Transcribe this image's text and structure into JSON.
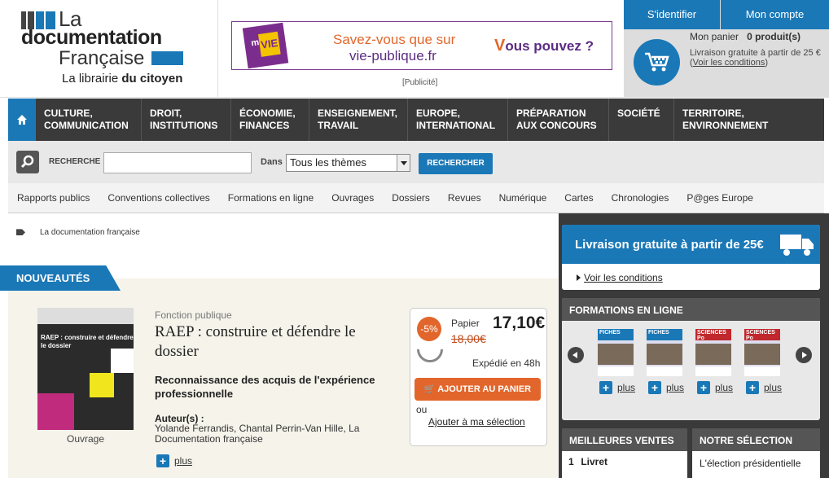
{
  "header": {
    "logo": {
      "line1": "La",
      "line2": "documentation",
      "line3": "Française",
      "tagline_prefix": "La librairie ",
      "tagline_bold": "du citoyen"
    },
    "banner": {
      "logo_top": "mon",
      "logo_mid": "VIE",
      "text1": "Savez-vous que sur",
      "text2": "vie-publique.fr",
      "text3_prefix": "V",
      "text3_rest": "ous pouvez ?"
    },
    "pub_note": "[Publicité]",
    "account": {
      "identifier": "S'identifier",
      "mon_compte": "Mon compte",
      "panier_label": "Mon panier",
      "panier_count": "0 produit(s)",
      "livraison_text": "Livraison gratuite à partir de 25 €",
      "livraison_link": "Voir les conditions"
    }
  },
  "nav": {
    "items": [
      {
        "l1": "CULTURE,",
        "l2": "COMMUNICATION"
      },
      {
        "l1": "DROIT,",
        "l2": "INSTITUTIONS"
      },
      {
        "l1": "ÉCONOMIE,",
        "l2": "FINANCES"
      },
      {
        "l1": "ENSEIGNEMENT,",
        "l2": "TRAVAIL"
      },
      {
        "l1": "EUROPE,",
        "l2": "INTERNATIONAL"
      },
      {
        "l1": "PRÉPARATION",
        "l2": "AUX CONCOURS"
      },
      {
        "l1": "SOCIÉTÉ",
        "l2": ""
      },
      {
        "l1": "TERRITOIRE,",
        "l2": "ENVIRONNEMENT"
      }
    ]
  },
  "search": {
    "label": "RECHERCHE",
    "input_value": "",
    "dans": "Dans",
    "select_value": "Tous les thèmes",
    "button": "RECHERCHER"
  },
  "subnav": [
    "Rapports publics",
    "Conventions collectives",
    "Formations en ligne",
    "Ouvrages",
    "Dossiers",
    "Revues",
    "Numérique",
    "Cartes",
    "Chronologies",
    "P@ges Europe"
  ],
  "breadcrumb": "La documentation française",
  "nouveautes": {
    "tab": "NOUVEAUTÉS",
    "cover_title": "RAEP : construire et défendre le dossier",
    "format": "Ouvrage",
    "category": "Fonction publique",
    "title": "RAEP : construire et défendre le dossier",
    "subtitle": "Reconnaissance des acquis de l'expérience professionnelle",
    "auteurs_label": "Auteur(s) :",
    "auteurs": "Yolande Ferrandis, Chantal Perrin-Van Hille, La Documentation française",
    "plus": "plus",
    "price": {
      "discount": "-5%",
      "papier": "Papier",
      "new": "17,10€",
      "old": "18,00€",
      "shipping": "Expédié en 48h",
      "add_cart": "AJOUTER AU PANIER",
      "ou": "ou",
      "add_selection": "Ajouter à ma sélection"
    }
  },
  "sidebar": {
    "livraison_title": "Livraison gratuite à partir de 25€",
    "voir_conditions": "Voir les conditions",
    "formations_title": "FORMATIONS EN LIGNE",
    "thumbs": [
      {
        "label": "FICHES",
        "color": "#1a78b7",
        "plus": "plus"
      },
      {
        "label": "FICHES",
        "color": "#1a78b7",
        "plus": "plus"
      },
      {
        "label": "SCIENCES Po",
        "color": "#c0282d",
        "plus": "plus"
      },
      {
        "label": "SCIENCES Po",
        "color": "#c0282d",
        "plus": "plus"
      }
    ],
    "ventes_title": "MEILLEURES VENTES",
    "ventes_item_num": "1",
    "ventes_item": "Livret",
    "selection_title": "NOTRE SÉLECTION",
    "selection_item": "L'élection présidentielle"
  },
  "colors": {
    "accent": "#1a78b7",
    "orange": "#e2662b",
    "nav_bg": "#3a3a3a"
  }
}
